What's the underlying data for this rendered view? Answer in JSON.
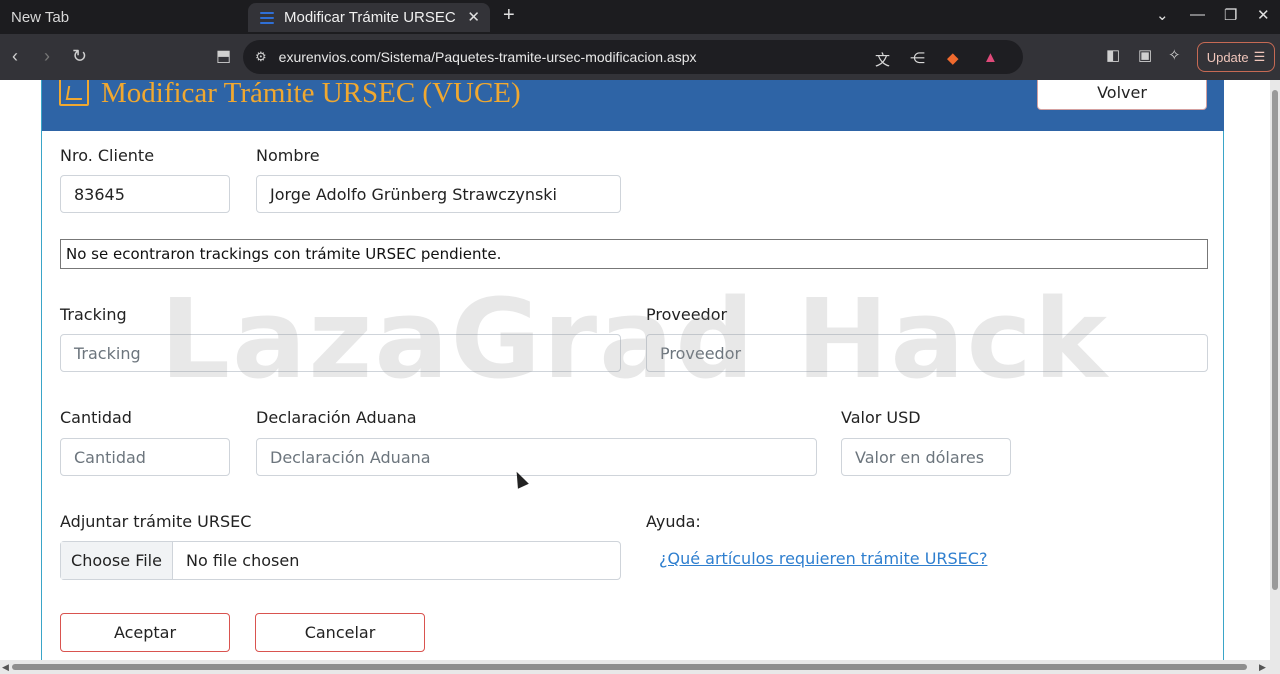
{
  "browser": {
    "tabs": [
      {
        "label": "New Tab"
      },
      {
        "label": "Modificar Trámite URSEC (VUCE)"
      }
    ],
    "url": "exurenvios.com/Sistema/Paquetes-tramite-ursec-modificacion.aspx",
    "update_label": "Update"
  },
  "header": {
    "title": "Modificar Trámite URSEC (VUCE)",
    "back_label": "Volver"
  },
  "form": {
    "client_no": {
      "label": "Nro. Cliente",
      "value": "83645"
    },
    "name": {
      "label": "Nombre",
      "value": "Jorge Adolfo Grünberg Strawczynski"
    },
    "alert": "No se econtraron trackings con trámite URSEC pendiente.",
    "tracking": {
      "label": "Tracking",
      "placeholder": "Tracking"
    },
    "provider": {
      "label": "Proveedor",
      "placeholder": "Proveedor"
    },
    "quantity": {
      "label": "Cantidad",
      "placeholder": "Cantidad"
    },
    "customs": {
      "label": "Declaración Aduana",
      "placeholder": "Declaración Aduana"
    },
    "value_usd": {
      "label": "Valor USD",
      "placeholder": "Valor en dólares"
    },
    "attach": {
      "label": "Adjuntar trámite URSEC",
      "button": "Choose File",
      "status": "No file chosen"
    },
    "help": {
      "label": "Ayuda:",
      "link": "¿Qué artículos requieren trámite URSEC?"
    },
    "accept_label": "Aceptar",
    "cancel_label": "Cancelar"
  },
  "watermark": "LazaGrad Hack"
}
